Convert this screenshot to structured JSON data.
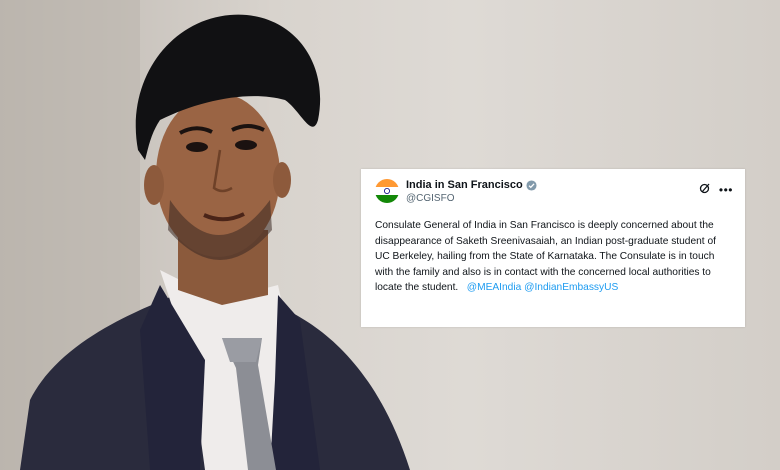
{
  "tweet": {
    "account_name": "India in San Francisco",
    "handle": "@CGISFO",
    "text": "Consulate General of India in San Francisco is deeply concerned about the disappearance of Saketh Sreenivasaiah, an Indian post-graduate student of UC Berkeley, hailing from the State of Karnataka. The Consulate is in touch with the family and also is in contact with the concerned local authorities to locate the student.",
    "mentions": [
      "@MEAIndia",
      "@IndianEmbassyUS"
    ],
    "icons": {
      "verified": "verified-badge-icon",
      "grok": "grok-icon",
      "more": "more-options-icon"
    },
    "colors": {
      "link": "#1d9bf0",
      "verified": "#829aab",
      "text": "#0f1419",
      "secondary": "#536471"
    }
  }
}
